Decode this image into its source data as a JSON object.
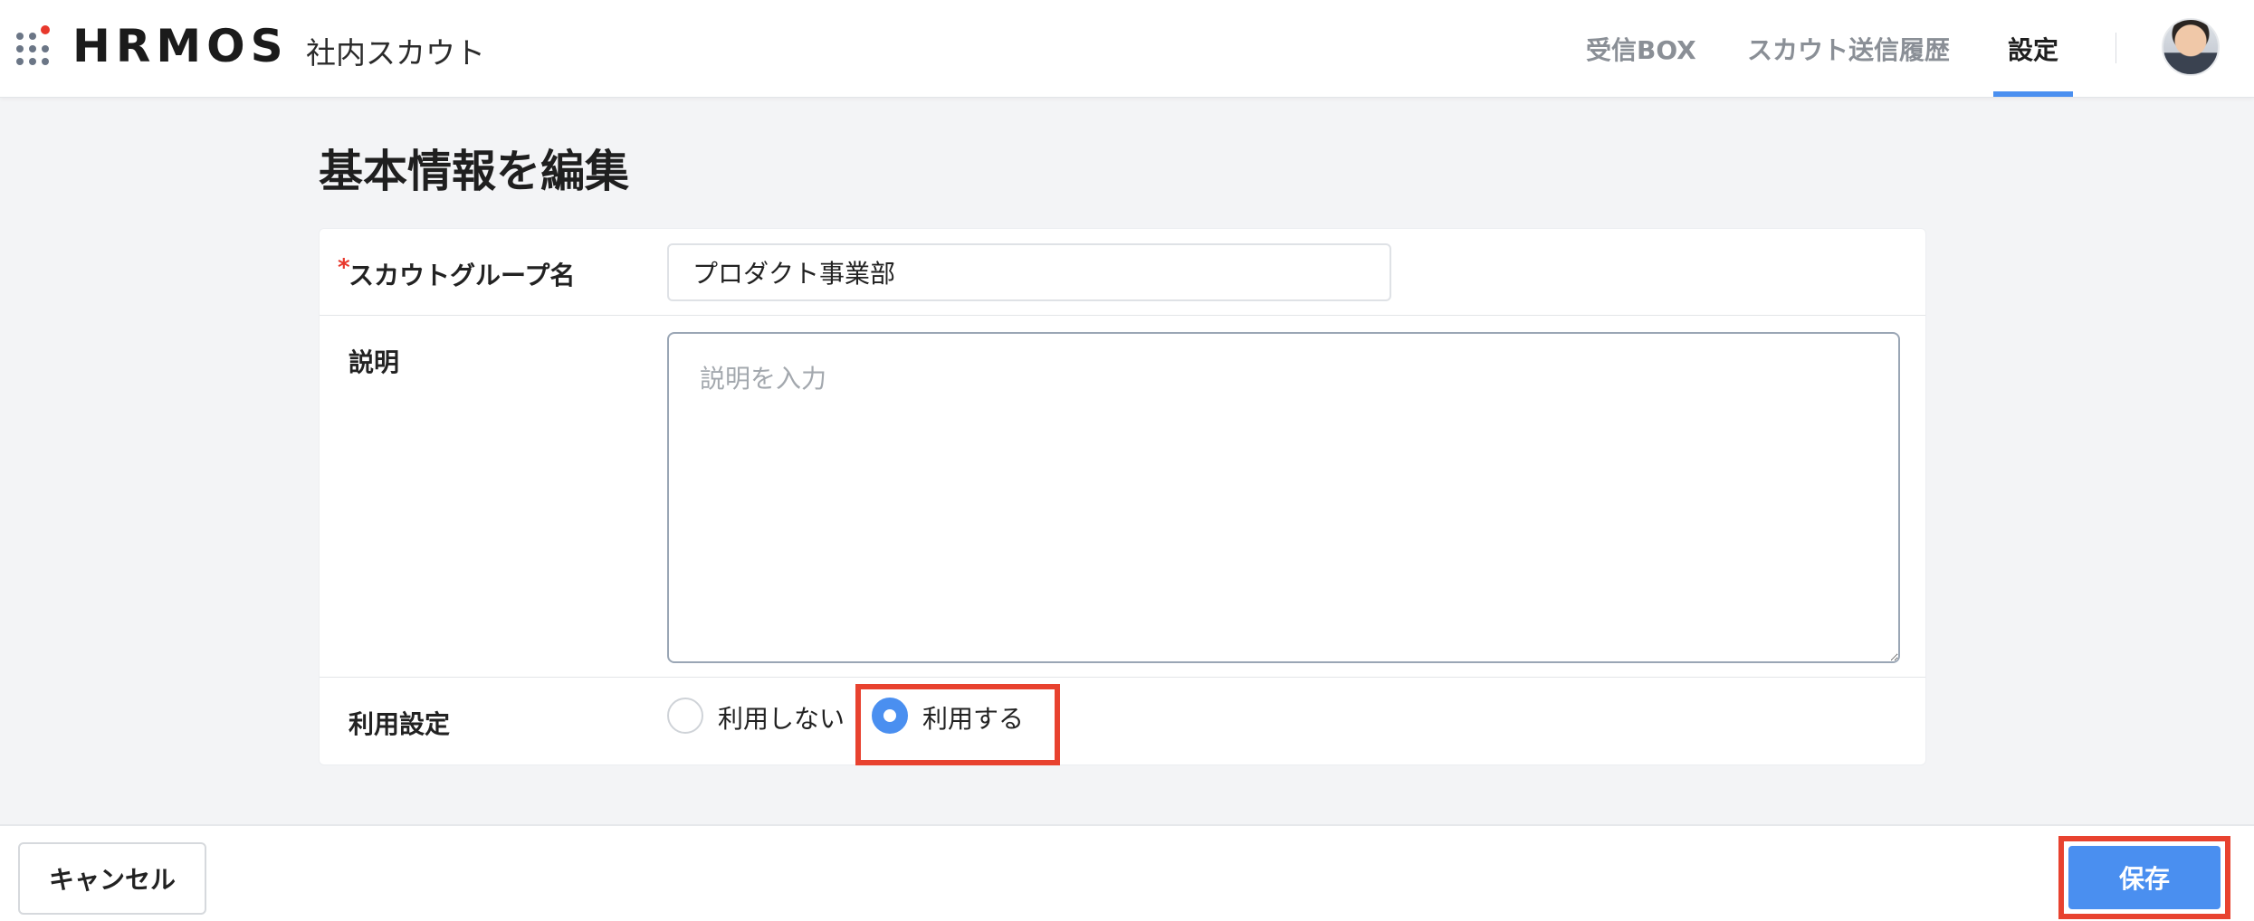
{
  "header": {
    "logo": "HRMOS",
    "product": "社内スカウト",
    "tabs": [
      {
        "label": "受信BOX",
        "active": false
      },
      {
        "label": "スカウト送信履歴",
        "active": false
      },
      {
        "label": "設定",
        "active": true
      }
    ]
  },
  "page": {
    "title": "基本情報を編集"
  },
  "form": {
    "group_name": {
      "required_mark": "*",
      "label": "スカウトグループ名",
      "value": "プロダクト事業部"
    },
    "description": {
      "label": "説明",
      "value": "",
      "placeholder": "説明を入力"
    },
    "usage": {
      "label": "利用設定",
      "options": [
        {
          "label": "利用しない",
          "checked": false
        },
        {
          "label": "利用する",
          "checked": true
        }
      ]
    }
  },
  "footer": {
    "cancel_label": "キャンセル",
    "save_label": "保存"
  },
  "colors": {
    "accent": "#4a8ff0",
    "highlight": "#e8422f",
    "required": "#e8382c"
  }
}
